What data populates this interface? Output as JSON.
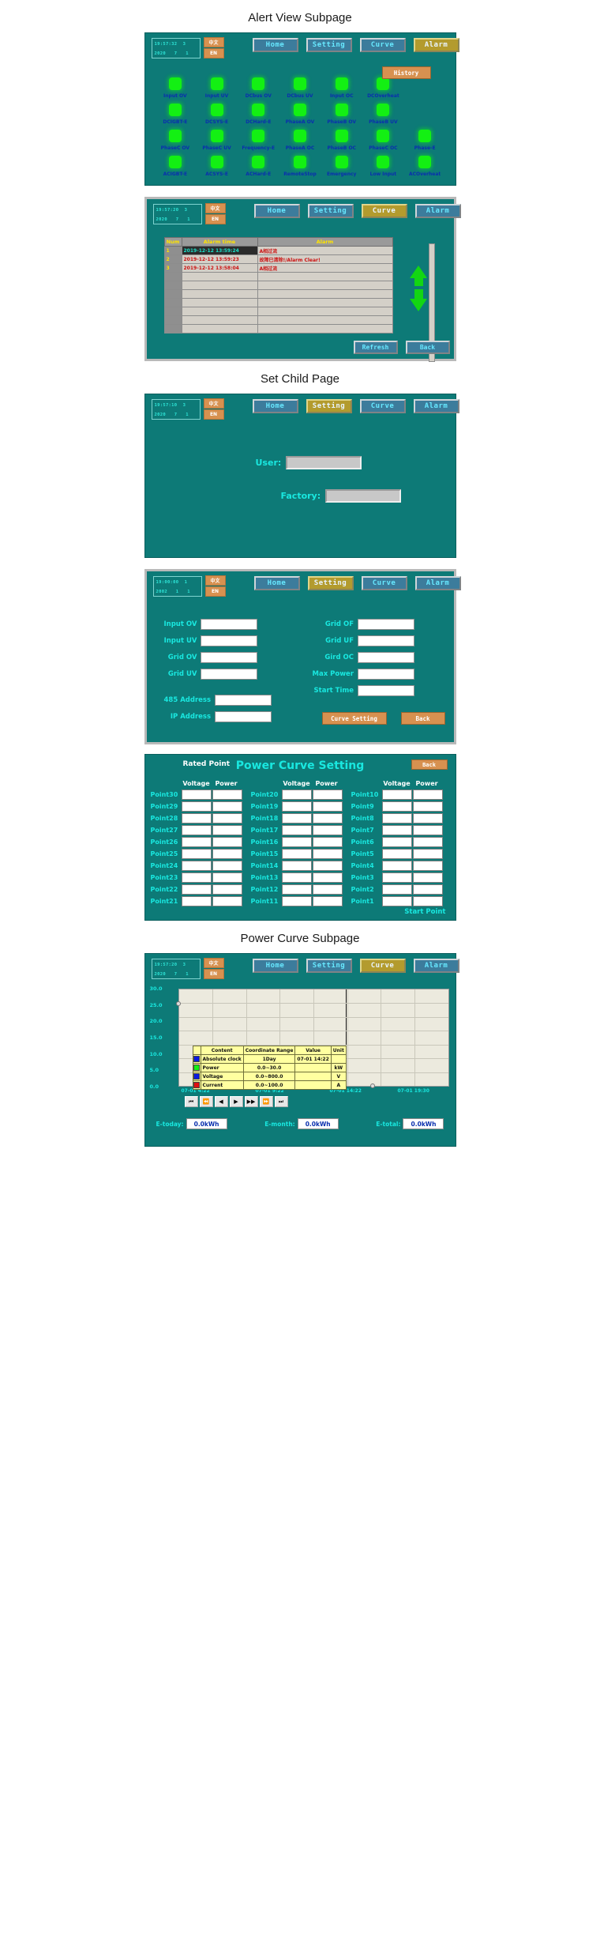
{
  "sections": [
    {
      "title": "Alert View Subpage"
    },
    {
      "title": "Set Child Page"
    },
    {
      "title": "Power Curve Subpage"
    }
  ],
  "nav": {
    "home": "Home",
    "setting": "Setting",
    "curve": "Curve",
    "alarm": "Alarm"
  },
  "lang": {
    "cn": "中文",
    "en": "EN"
  },
  "clock1": {
    "time": "19:57:32  3",
    "date": "2020   7   1"
  },
  "clock2": {
    "time": "19:57:20  3",
    "date": "2020   7   1"
  },
  "clock3": {
    "time": "19:57:10  3",
    "date": "2020   7   1"
  },
  "clock4": {
    "time": "19:00:00  1",
    "date": "2002   1   1"
  },
  "clock5": {
    "time": "19:57:20  3",
    "date": "2020   7   1"
  },
  "alert_page": {
    "history_button": "History",
    "leds": [
      "Input OV",
      "Input UV",
      "DCbus OV",
      "DCbus UV",
      "Input OC",
      "DCOverheat",
      "",
      "DCIGBT-E",
      "DCSYS-E",
      "DCHard-E",
      "PhaseA OV",
      "PhaseB OV",
      "PhaseB UV",
      "",
      "PhaseC OV",
      "PhaseC UV",
      "Frequency-E",
      "PhaseA OC",
      "PhaseB OC",
      "PhaseC OC",
      "Phase-E",
      "ACIGBT-E",
      "ACSYS-E",
      "ACHard-E",
      "RemoteStop",
      "Emergency",
      "Low Input",
      "ACOverheat"
    ]
  },
  "alarm_table": {
    "headers": [
      "Num",
      "Alarm time",
      "Alarm"
    ],
    "rows": [
      {
        "num": "1",
        "time": "2019-12-12 13:59:24",
        "msg": "A相过流",
        "selected": true
      },
      {
        "num": "2",
        "time": "2019-12-12 13:59:23",
        "msg": "故障已清除!/Alarm Clear!",
        "selected": false
      },
      {
        "num": "3",
        "time": "2019-12-12 13:58:04",
        "msg": "A相过流",
        "selected": false
      },
      {
        "num": "",
        "time": "",
        "msg": "",
        "selected": false
      },
      {
        "num": "",
        "time": "",
        "msg": "",
        "selected": false
      },
      {
        "num": "",
        "time": "",
        "msg": "",
        "selected": false
      },
      {
        "num": "",
        "time": "",
        "msg": "",
        "selected": false
      },
      {
        "num": "",
        "time": "",
        "msg": "",
        "selected": false
      },
      {
        "num": "",
        "time": "",
        "msg": "",
        "selected": false
      },
      {
        "num": "",
        "time": "",
        "msg": "",
        "selected": false
      }
    ],
    "refresh_button": "Refresh",
    "back_button": "Back"
  },
  "login_page": {
    "user_label": "User:",
    "user_value": "",
    "factory_label": "Factory:",
    "factory_value": ""
  },
  "param_page": {
    "left": [
      {
        "label": "Input OV",
        "value": ""
      },
      {
        "label": "Input UV",
        "value": ""
      },
      {
        "label": "Grid OV",
        "value": ""
      },
      {
        "label": "Grid UV",
        "value": ""
      }
    ],
    "right": [
      {
        "label": "Grid OF",
        "value": ""
      },
      {
        "label": "Grid UF",
        "value": ""
      },
      {
        "label": "Gird OC",
        "value": ""
      },
      {
        "label": "Max Power",
        "value": ""
      },
      {
        "label": "Start Time",
        "value": ""
      }
    ],
    "bottom_left": [
      {
        "label": "485 Address",
        "value": ""
      },
      {
        "label": "IP Address",
        "value": ""
      }
    ],
    "curve_setting_button": "Curve Setting",
    "back_button": "Back"
  },
  "power_curve_setting": {
    "title": "Power Curve Setting",
    "rated_point": "Rated Point",
    "back_button": "Back",
    "col_voltage": "Voltage",
    "col_power": "Power",
    "start_point": "Start Point",
    "columns": [
      [
        "Point30",
        "Point29",
        "Point28",
        "Point27",
        "Point26",
        "Point25",
        "Point24",
        "Point23",
        "Point22",
        "Point21"
      ],
      [
        "Point20",
        "Point19",
        "Point18",
        "Point17",
        "Point16",
        "Point15",
        "Point14",
        "Point13",
        "Point12",
        "Point11"
      ],
      [
        "Point10",
        "Point9",
        "Point8",
        "Point7",
        "Point6",
        "Point5",
        "Point4",
        "Point3",
        "Point2",
        "Point1"
      ]
    ]
  },
  "chart_page": {
    "legend": {
      "headers": [
        "",
        "Content",
        "Coordinate Range",
        "Value",
        "Unit"
      ],
      "rows": [
        {
          "color": "#0b1ae0",
          "content": "Absolute clock",
          "range": "1Day",
          "value": "07-01 14:22",
          "unit": ""
        },
        {
          "color": "#13f013",
          "content": "Power",
          "range": "0.0~30.0",
          "value": "",
          "unit": "kW"
        },
        {
          "color": "#0b1ae0",
          "content": "Voltage",
          "range": "0.0~800.0",
          "value": "",
          "unit": "V"
        },
        {
          "color": "#e01010",
          "content": "Current",
          "range": "0.0~100.0",
          "value": "",
          "unit": "A"
        }
      ]
    },
    "yticks": [
      "30.0",
      "25.0",
      "20.0",
      "15.0",
      "10.0",
      "5.0",
      "0.0"
    ],
    "xticks": [
      "07-01 4:22",
      "07-01 9:22",
      "07-01 14:22",
      "07-01 19:30"
    ],
    "playbuttons": [
      "⏮",
      "⏪",
      "◀",
      "▶",
      "▶▶",
      "⏩",
      "⏭"
    ],
    "energy": [
      {
        "label": "E-today:",
        "value": "0.0kWh"
      },
      {
        "label": "E-month:",
        "value": "0.0kWh"
      },
      {
        "label": "E-total:",
        "value": "0.0kWh"
      }
    ]
  },
  "colors": {
    "teal": "#0d7a77",
    "led_green": "#13f013",
    "label_blue": "#0a2fae",
    "cyan": "#19e8e0",
    "orange": "#d79150",
    "nav_blue": "#3c7c9c",
    "nav_active": "#b39b2e"
  }
}
